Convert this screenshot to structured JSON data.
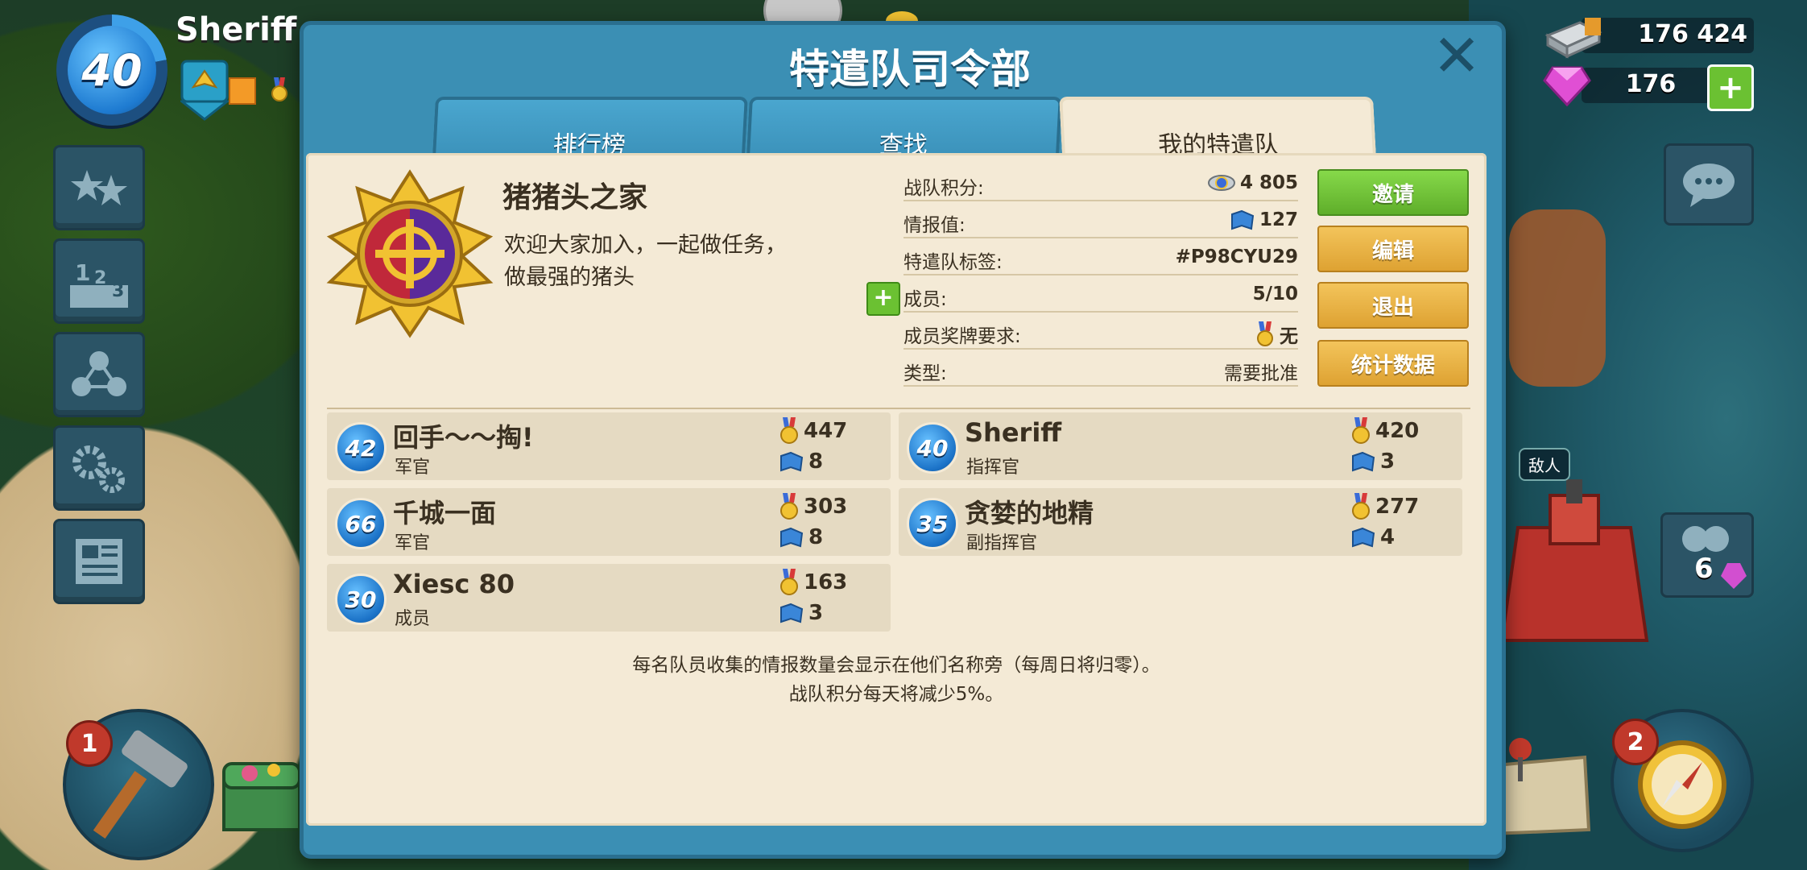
{
  "hud": {
    "player_level": "40",
    "player_name": "Sheriff",
    "steel": "176 424",
    "gems": "176",
    "hammer_badge": "1",
    "compass_badge": "2",
    "troops_count": "6",
    "enemy_tag": "敌人"
  },
  "modal": {
    "title": "特遣队司令部",
    "close": "✕",
    "tabs": [
      {
        "label": "排行榜"
      },
      {
        "label": "查找"
      },
      {
        "label": "我的特遣队"
      }
    ]
  },
  "task_force": {
    "name": "猪猪头之家",
    "description_line1": "欢迎大家加入，一起做任务，",
    "description_line2": "做最强的猪头",
    "info": [
      {
        "key": "战队积分:",
        "value": "4 805",
        "icon": "rank-medal-icon"
      },
      {
        "key": "情报值:",
        "value": "127",
        "icon": "intel-map-icon"
      },
      {
        "key": "特遣队标签:",
        "value": "#P98CYU29",
        "icon": ""
      },
      {
        "key": "成员:",
        "value": "5/10",
        "icon": ""
      },
      {
        "key": "成员奖牌要求:",
        "value": "无",
        "icon": "medal-icon"
      },
      {
        "key": "类型:",
        "value": "需要批准",
        "icon": ""
      }
    ],
    "actions": {
      "invite": "邀请",
      "edit": "编辑",
      "leave": "退出",
      "stats": "统计数据"
    }
  },
  "members": [
    {
      "level": "42",
      "name": "回手～～掏!",
      "role": "军官",
      "medals": "447",
      "intel": "8"
    },
    {
      "level": "40",
      "name": "Sheriff",
      "role": "指挥官",
      "medals": "420",
      "intel": "3"
    },
    {
      "level": "66",
      "name": "千城一面",
      "role": "军官",
      "medals": "303",
      "intel": "8"
    },
    {
      "level": "35",
      "name": "贪婪的地精",
      "role": "副指挥官",
      "medals": "277",
      "intel": "4"
    },
    {
      "level": "30",
      "name": "Xiesc 80",
      "role": "成员",
      "medals": "163",
      "intel": "3"
    }
  ],
  "footer": {
    "note_line1": "每名队员收集的情报数量会显示在他们名称旁（每周日将归零）。",
    "note_line2": "战队积分每天将减少5%。"
  },
  "colors": {
    "modal_blue": "#3b8fb4",
    "paper": "#f4ead6",
    "invite_green": "#6bc132",
    "action_gold": "#e8b142",
    "level_blue": "#1b72c7"
  }
}
